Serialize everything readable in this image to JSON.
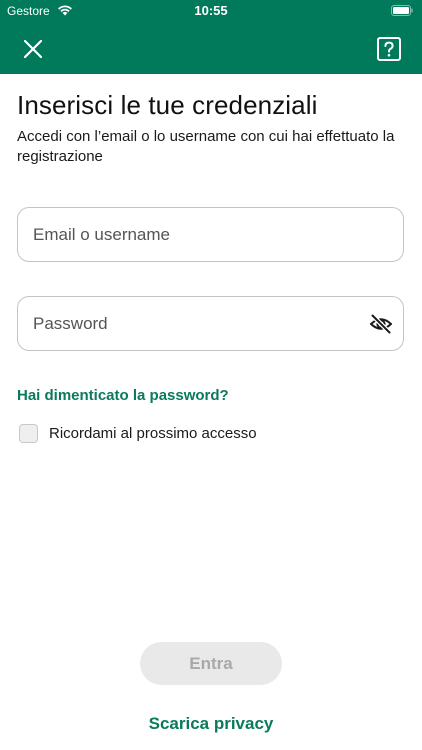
{
  "status_bar": {
    "carrier": "Gestore",
    "time": "10:55",
    "wifi_icon": "wifi-icon",
    "battery_icon": "battery-icon"
  },
  "nav_bar": {
    "background_color": "#017a5b",
    "close_icon": "close-icon",
    "help_icon": "help-icon"
  },
  "login": {
    "title": "Inserisci le tue credenziali",
    "subtitle": "Accedi con l’email o lo username con cui hai effettuato la registrazione",
    "email_field": {
      "placeholder": "Email o username",
      "value": ""
    },
    "password_field": {
      "placeholder": "Password",
      "value": "",
      "toggle_icon": "eye-slash-icon"
    },
    "forgot_password_label": "Hai dimenticato la password?",
    "remember_me": {
      "label": "Ricordami al prossimo accesso",
      "checked": false
    },
    "submit_label": "Entra",
    "submit_enabled": false,
    "privacy_label": "Scarica privacy"
  },
  "colors": {
    "brand_green": "#017a5b",
    "link_green": "#0a7a5c",
    "disabled_button_bg": "#e9e9e9",
    "disabled_button_text": "#a9a9a9"
  }
}
